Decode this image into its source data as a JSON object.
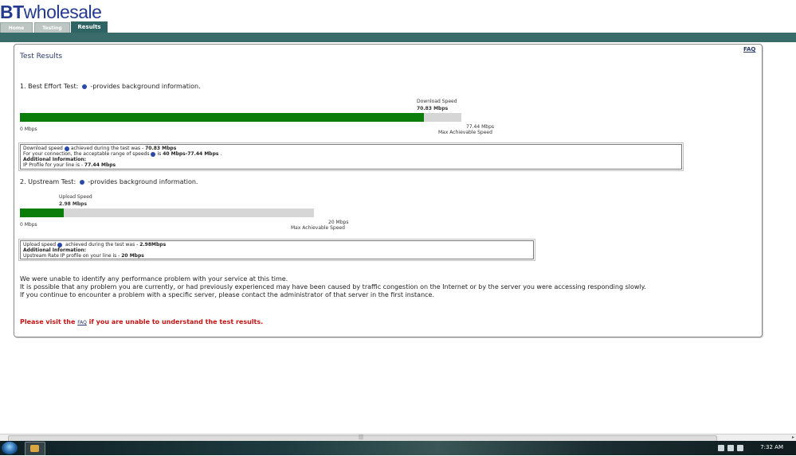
{
  "logo": {
    "bt": "BT",
    "wholesale": "wholesale"
  },
  "tabs": [
    {
      "label": "Home"
    },
    {
      "label": "Testing"
    },
    {
      "label": "Results"
    }
  ],
  "panel": {
    "title": "Test Results",
    "faq_link": "FAQ"
  },
  "best_effort": {
    "heading_prefix": "1. Best Effort Test:",
    "heading_suffix": "-provides background information.",
    "speed_label": "Download Speed",
    "speed_value": "70.83 Mbps",
    "min_label": "0 Mbps",
    "max_value": "77.44 Mbps",
    "max_label": "Max Achievable Speed",
    "fill_fraction": 0.915,
    "info": {
      "line1_a": "Download speed",
      "line1_b": "achieved during the test was - ",
      "line1_val": "70.83 Mbps",
      "line2_a": "For your connection, the acceptable range of speeds",
      "line2_b": "is ",
      "line2_val": "40 Mbps-77.44 Mbps",
      "line2_end": " .",
      "line3": "Additional Information:",
      "line4_a": "IP Profile for your line is - ",
      "line4_val": "77.44 Mbps"
    }
  },
  "upstream": {
    "heading_prefix": "2. Upstream Test:",
    "heading_suffix": "-provides background information.",
    "speed_label": "Upload Speed",
    "speed_value": "2.98 Mbps",
    "min_label": "0 Mbps",
    "max_value": "20 Mbps",
    "max_label": "Max Achievable Speed",
    "fill_fraction": 0.149,
    "info": {
      "line1_a": "Upload speed",
      "line1_b": " achieved during the test was - ",
      "line1_val": "2.98Mbps",
      "line2": "Additional Information:",
      "line3_a": "Upstream Rate IP profile on your line is - ",
      "line3_val": "20 Mbps"
    }
  },
  "messages": {
    "line1": "We were unable to identify any performance problem with your service at this time.",
    "line2": "It is possible that any problem you are currently, or had previously experienced may have been caused by traffic congestion on the Internet or by the server you were accessing responding slowly.",
    "line3": "If you continue to encounter a problem with a specific server, please contact the administrator of that server in the first instance.",
    "visit_a": "Please visit the ",
    "visit_link": "FAQ",
    "visit_b": " if you are unable to understand the test results."
  },
  "taskbar": {
    "clock": "7:32 AM"
  },
  "colors": {
    "accent": "#3a6b6b",
    "bar_fill": "#0a7d0a",
    "bar_track": "#d6d6d6",
    "warning_text": "#c21414",
    "logo": "#243a8f"
  }
}
